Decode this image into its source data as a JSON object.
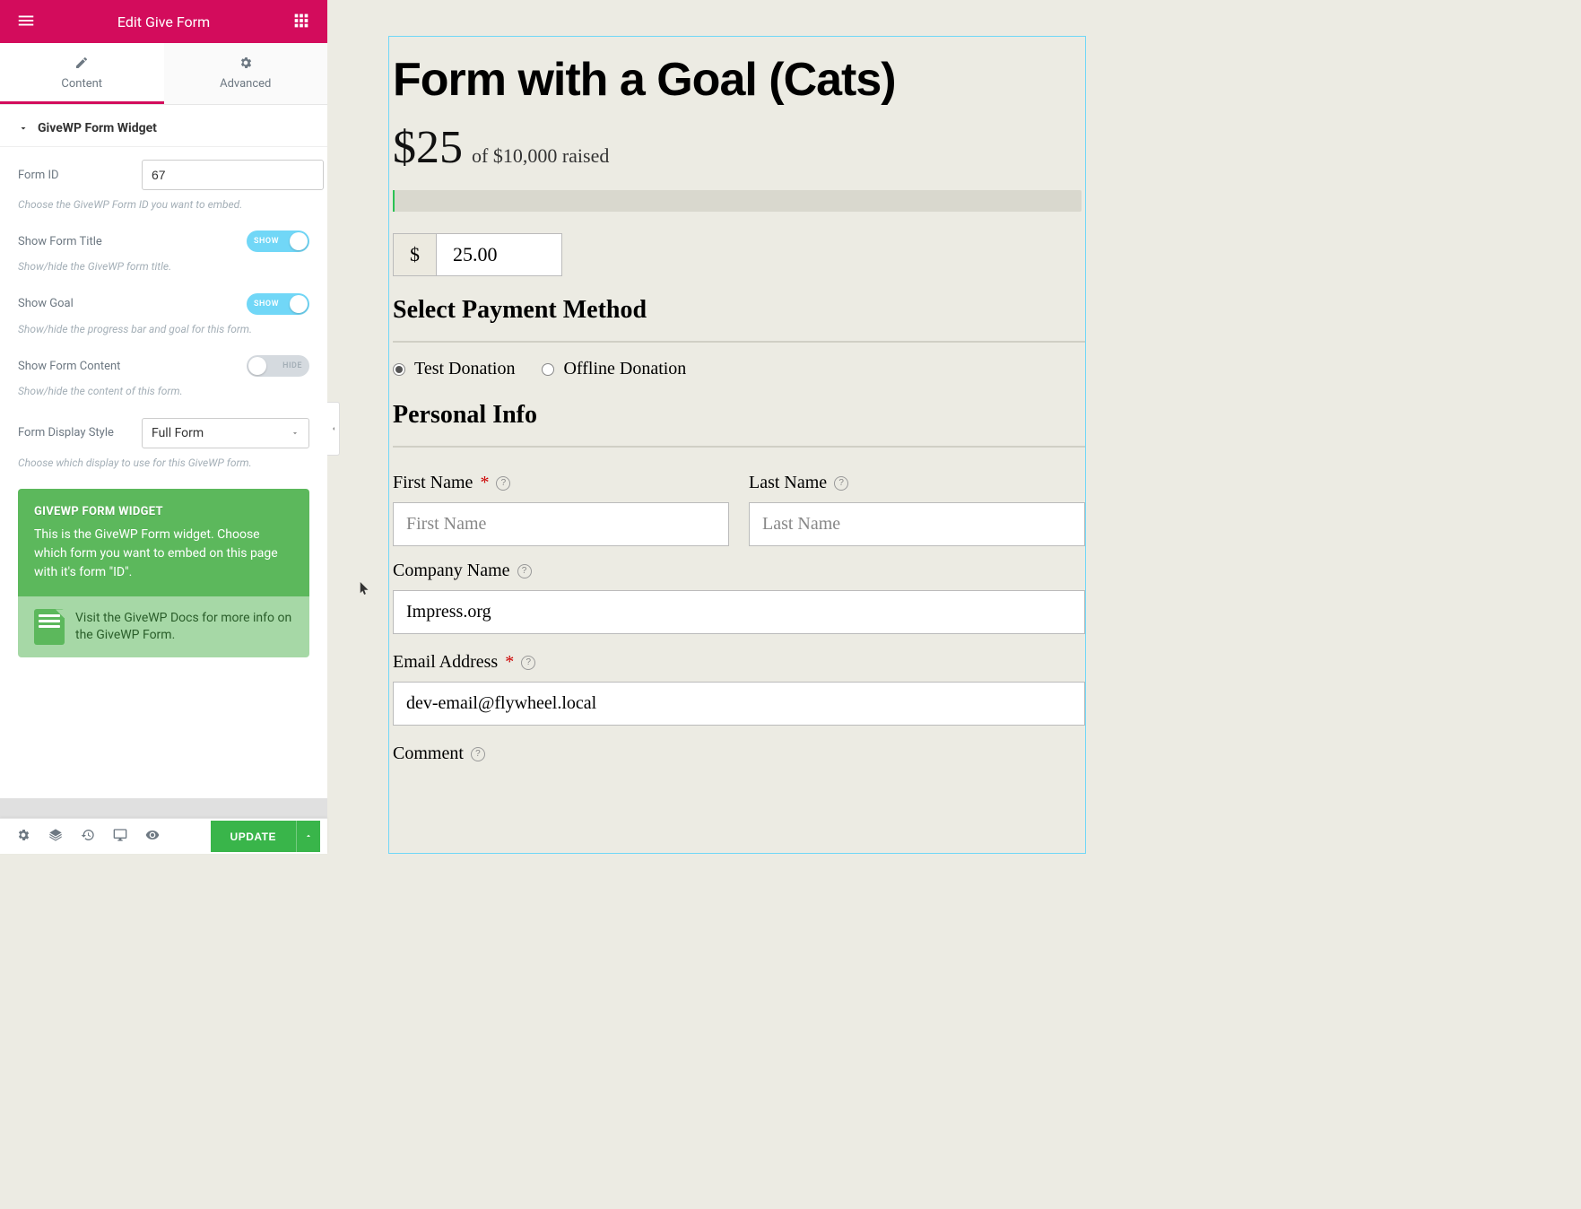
{
  "header": {
    "title": "Edit Give Form"
  },
  "tabs": {
    "content": "Content",
    "advanced": "Advanced"
  },
  "section": {
    "title": "GiveWP Form Widget"
  },
  "controls": {
    "form_id": {
      "label": "Form ID",
      "value": "67",
      "help": "Choose the GiveWP Form ID you want to embed."
    },
    "show_title": {
      "label": "Show Form Title",
      "state": "SHOW",
      "help": "Show/hide the GiveWP form title."
    },
    "show_goal": {
      "label": "Show Goal",
      "state": "SHOW",
      "help": "Show/hide the progress bar and goal for this form."
    },
    "show_content": {
      "label": "Show Form Content",
      "state": "HIDE",
      "help": "Show/hide the content of this form."
    },
    "display_style": {
      "label": "Form Display Style",
      "value": "Full Form",
      "help": "Choose which display to use for this GiveWP form."
    }
  },
  "infobox": {
    "title": "GIVEWP FORM WIDGET",
    "body": "This is the GiveWP Form widget. Choose which form you want to embed on this page with it's form \"ID\".",
    "docs": "Visit the GiveWP Docs for more info on the GiveWP Form."
  },
  "footer": {
    "update": "UPDATE"
  },
  "preview": {
    "form_title": "Form with a Goal (Cats)",
    "raised_amount": "$25",
    "raised_text": "of $10,000 raised",
    "currency": "$",
    "amount": "25.00",
    "payment_heading": "Select Payment Method",
    "payment_opt1": "Test Donation",
    "payment_opt2": "Offline Donation",
    "personal_heading": "Personal Info",
    "first_name": {
      "label": "First Name",
      "placeholder": "First Name"
    },
    "last_name": {
      "label": "Last Name",
      "placeholder": "Last Name"
    },
    "company": {
      "label": "Company Name",
      "value": "Impress.org"
    },
    "email": {
      "label": "Email Address",
      "value": "dev-email@flywheel.local"
    },
    "comment": {
      "label": "Comment"
    }
  }
}
